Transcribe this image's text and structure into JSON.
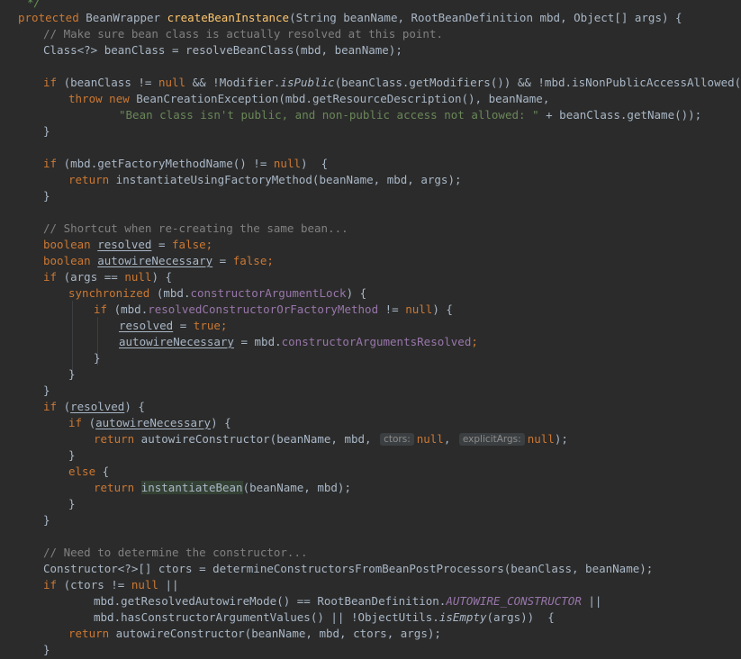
{
  "code": {
    "comment_end": "*/",
    "signature_modifier": "protected",
    "signature_type": "BeanWrapper",
    "signature_method": "createBeanInstance",
    "signature_params": "(String beanName, RootBeanDefinition mbd, Object[] args) {",
    "comment_resolved": "// Make sure bean class is actually resolved at this point.",
    "decl_beanclass": "Class<?> beanClass = resolveBeanClass(mbd, beanName);",
    "if_public_a": "if",
    "if_public_b": " (beanClass != ",
    "null": "null",
    "if_public_c": " && !Modifier.",
    "is_public": "isPublic",
    "if_public_d": "(beanClass.getModifiers()) && !mbd.isNonPublicAccessAllowed()) {",
    "throw": "throw",
    "new": "new",
    "throw_rest": " BeanCreationException(mbd.getResourceDescription(), beanName,",
    "throw_msg": "\"Bean class isn't public, and non-public access not allowed: \"",
    "throw_msg_rest": " + beanClass.getName());",
    "brace_close": "}",
    "if_factory_a": "(mbd.getFactoryMethodName() != ",
    "if_factory_b": ")  {",
    "return": "return",
    "ret_factory": " instantiateUsingFactoryMethod(beanName, mbd, args);",
    "comment_shortcut": "// Shortcut when re-creating the same bean...",
    "boolean": "boolean",
    "resolved": "resolved",
    "autowire_necessary": "autowireNecessary",
    "false": "false",
    "true": "true",
    "assign_eq": " = ",
    "semi": ";",
    "if_args_a": "(args == ",
    "if_args_b": ") {",
    "synchronized": "synchronized",
    "sync_a": " (mbd.",
    "ctor_arg_lock": "constructorArgumentLock",
    "sync_b": ") {",
    "if_resolved_ctor_a": " (mbd.",
    "resolved_ctor_field": "resolvedConstructorOrFactoryMethod",
    "if_resolved_ctor_b": " != ",
    "if_resolved_ctor_c": ") {",
    "autowire_assign_a": " = mbd.",
    "ctor_args_resolved": "constructorArgumentsResolved",
    "if_resolved_paren_open": " (",
    "if_resolved_paren_close": ") {",
    "ret_autowire_a": " autowireConstructor(beanName, mbd, ",
    "hint_ctors": "ctors:",
    "hint_explicit_args": "explicitArgs:",
    "comma_space": ", ",
    "ret_autowire_end": ");",
    "else": "else",
    "brace_open_sp": " {",
    "instantiate_bean": "instantiateBean",
    "ret_instantiate_rest": "(beanName, mbd);",
    "comment_determine": "// Need to determine the constructor...",
    "decl_ctors": "Constructor<?>[] ctors = determineConstructorsFromBeanPostProcessors(beanClass, beanName);",
    "if_ctors_a": " (ctors != ",
    "if_ctors_b": " ||",
    "cond_mode_a": "mbd.getResolvedAutowireMode() == RootBeanDefinition.",
    "autowire_constructor": "AUTOWIRE_CONSTRUCTOR",
    "cond_mode_b": " ||",
    "cond_values_a": "mbd.hasConstructorArgumentValues() || !ObjectUtils.",
    "is_empty": "isEmpty",
    "cond_values_b": "(args))  {",
    "ret_ctors": " autowireConstructor(beanName, mbd, ctors, args);"
  }
}
